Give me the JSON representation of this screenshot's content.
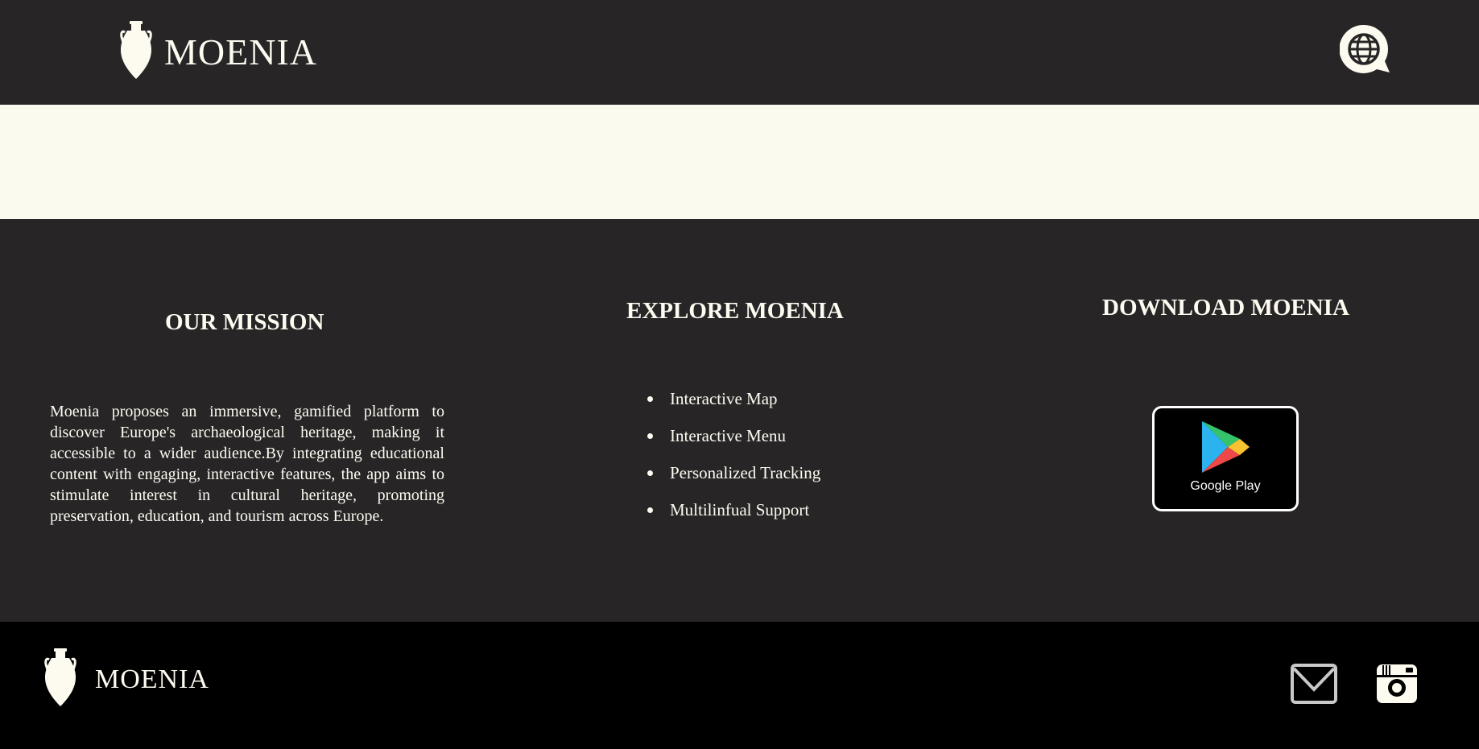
{
  "brand": {
    "name": "MOENIA"
  },
  "header": {
    "language_icon": "globe-chat-icon"
  },
  "mission": {
    "title": "OUR MISSION",
    "text": "Moenia proposes an immersive, gamified platform to discover Europe's archaeological heritage, making it accessible to a wider audience.By integrating educational content with engaging, interactive features, the app aims to stimulate interest in cultural heritage, promoting preservation, education, and tourism across Europe."
  },
  "explore": {
    "title": "EXPLORE MOENIA",
    "items": [
      "Interactive Map",
      "Interactive Menu",
      "Personalized Tracking",
      "Multilinfual Support"
    ]
  },
  "download": {
    "title": "DOWNLOAD MOENIA",
    "store_label": "Google Play",
    "store_icon": "google-play-icon"
  },
  "footer": {
    "brand": "MOENIA",
    "icons": [
      "mail-icon",
      "instagram-icon"
    ]
  },
  "colors": {
    "dark_bg": "#282527",
    "cream": "#fafaee",
    "footer_bg": "#000000",
    "text_light": "#fdfaf0"
  }
}
